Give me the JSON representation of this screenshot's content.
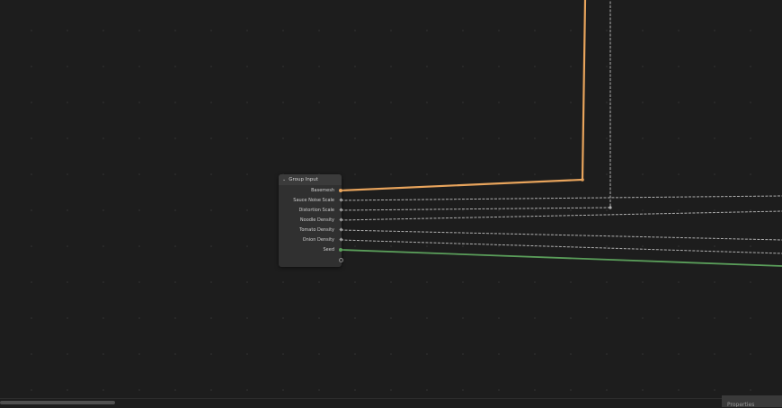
{
  "node": {
    "title": "Group Input",
    "collapse_icon": "chevron-down-icon",
    "sockets": [
      {
        "label": "Basemesh",
        "type": "geometry",
        "color": "#00d6a3"
      },
      {
        "label": "Sauce Noise Scale",
        "type": "float",
        "color": "#a1a1a1"
      },
      {
        "label": "Distortion Scale",
        "type": "float",
        "color": "#a1a1a1"
      },
      {
        "label": "Noodle Density",
        "type": "float",
        "color": "#a1a1a1"
      },
      {
        "label": "Tomato Density",
        "type": "float",
        "color": "#a1a1a1"
      },
      {
        "label": "Onion Density",
        "type": "float",
        "color": "#a1a1a1"
      },
      {
        "label": "Seed",
        "type": "integer",
        "color": "#5a9e5a"
      }
    ]
  },
  "colors": {
    "background": "#1d1d1d",
    "node_body": "#303030",
    "geometry_wire": "#e8a45c",
    "float_wire": "#b8b8b8",
    "integer_wire": "#5a9e5a"
  },
  "corner_tab": {
    "label": "Properties"
  }
}
